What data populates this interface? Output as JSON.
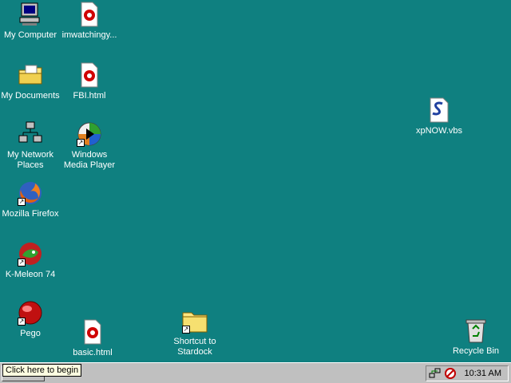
{
  "desktop": {
    "background": "#0f8080",
    "icons": [
      {
        "label": "My Computer",
        "icon": "computer-icon",
        "shortcut": false
      },
      {
        "label": "imwatchingy...",
        "icon": "html-file-icon",
        "shortcut": false
      },
      {
        "label": "My Documents",
        "icon": "folder-documents-icon",
        "shortcut": false
      },
      {
        "label": "FBI.html",
        "icon": "html-file-icon",
        "shortcut": false
      },
      {
        "label": "My Network Places",
        "icon": "network-icon",
        "shortcut": false
      },
      {
        "label": "Windows Media Player",
        "icon": "media-player-icon",
        "shortcut": true
      },
      {
        "label": "Mozilla Firefox",
        "icon": "firefox-icon",
        "shortcut": true
      },
      {
        "label": "K-Meleon 74",
        "icon": "kmeleon-icon",
        "shortcut": true
      },
      {
        "label": "Pego",
        "icon": "pego-icon",
        "shortcut": true
      },
      {
        "label": "basic.html",
        "icon": "html-file-icon",
        "shortcut": false
      },
      {
        "label": "Shortcut to Stardock",
        "icon": "folder-icon",
        "shortcut": true
      },
      {
        "label": "xpNOW.vbs",
        "icon": "script-file-icon",
        "shortcut": false
      },
      {
        "label": "Recycle Bin",
        "icon": "recycle-bin-icon",
        "shortcut": false
      }
    ]
  },
  "taskbar": {
    "tooltip": "Click here to begin",
    "clock": "10:31 AM",
    "tray_icons": [
      "network-tray-icon",
      "security-tray-icon"
    ]
  }
}
